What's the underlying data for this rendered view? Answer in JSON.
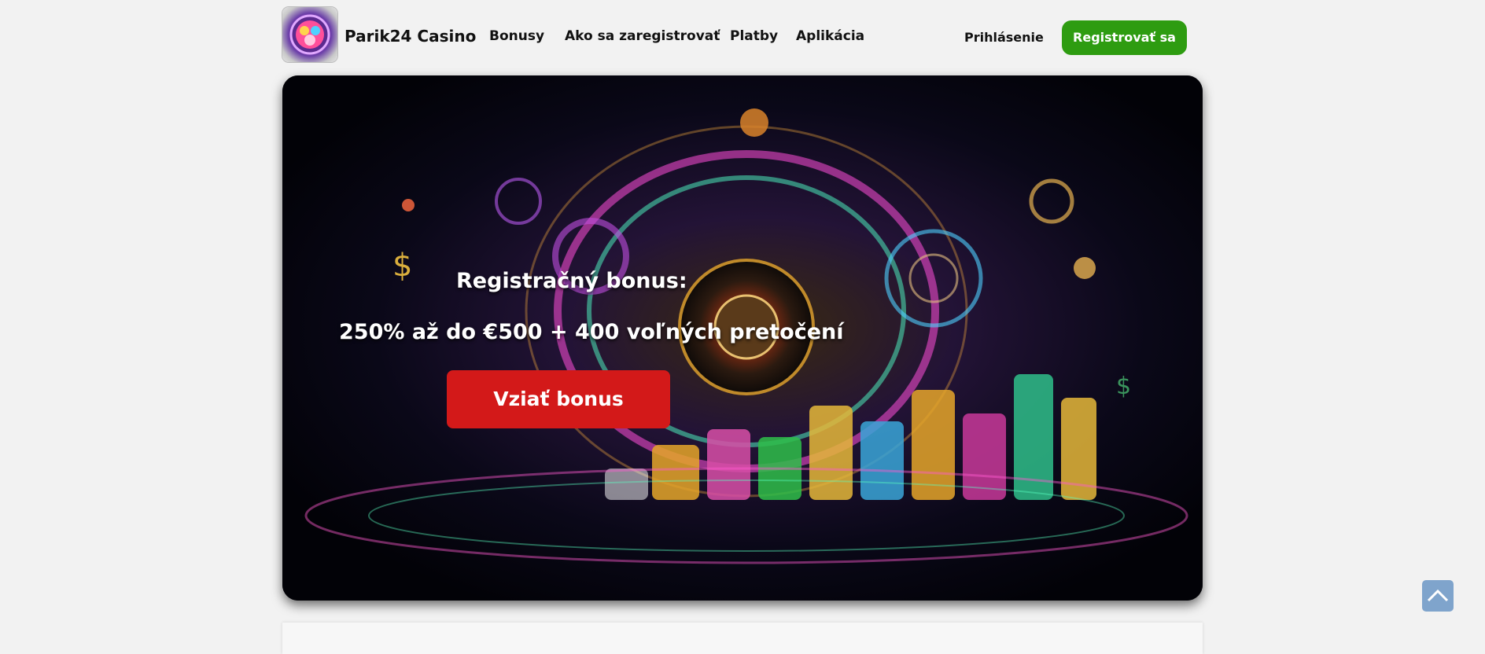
{
  "header": {
    "brand": "Parik24 Casino",
    "logo_icon": "casino-logo-icon",
    "nav": [
      "Bonusy",
      "Ako sa zaregistrovať",
      "Platby",
      "Aplikácia"
    ],
    "login_label": "Prihlásenie",
    "register_label": "Registrovať sa"
  },
  "hero": {
    "title": "Registračný bonus:",
    "offer": "250% až do €500 + 400 voľných pretočení",
    "cta_label": "Vziať bonus",
    "background_icon": "casino-roulette-chips-image"
  },
  "scroll_top": {
    "icon": "chevron-up-icon"
  },
  "colors": {
    "page_bg": "#f2f2f2",
    "register_green": "#2e9c11",
    "cta_red": "#d31919",
    "scroll_top_blue": "#7fa4cc"
  }
}
